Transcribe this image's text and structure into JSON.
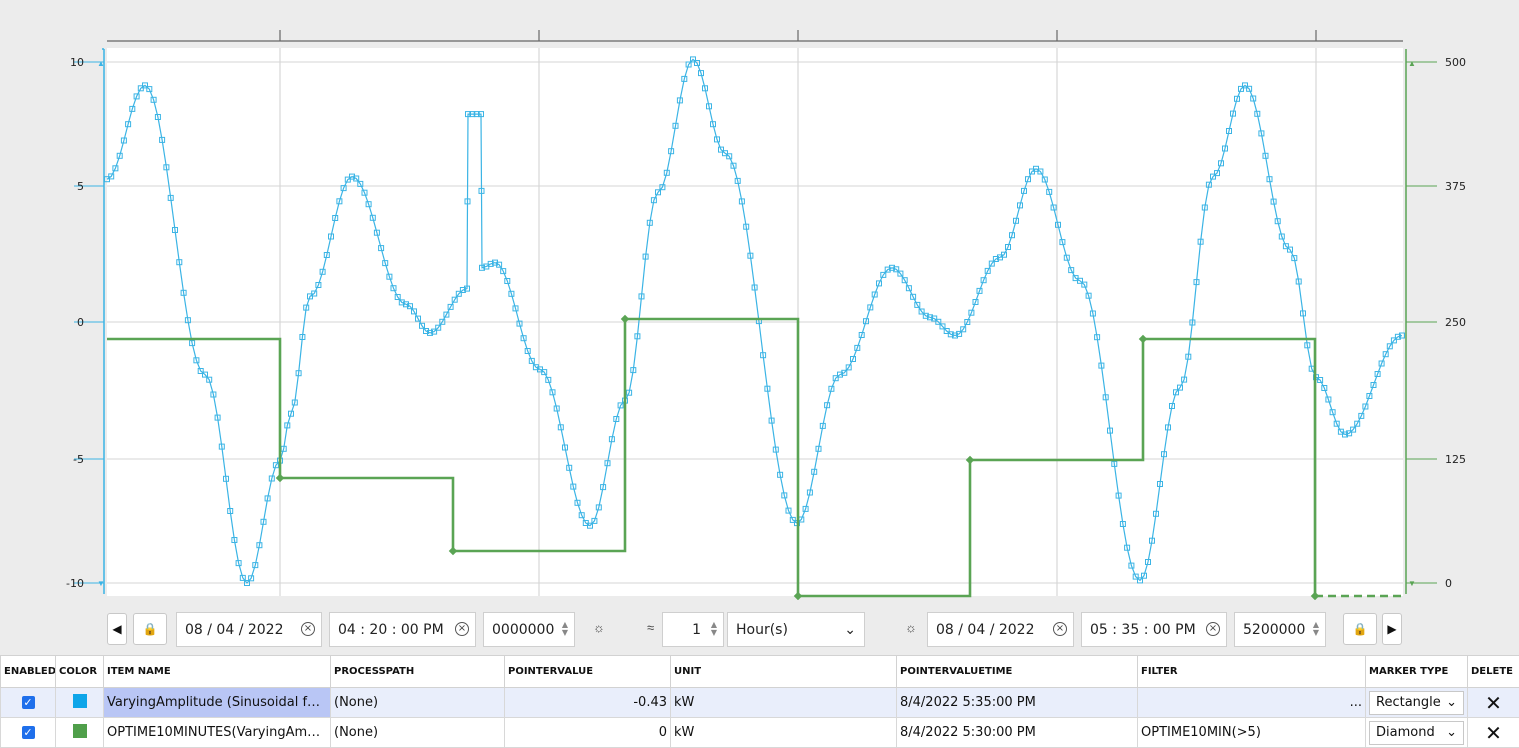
{
  "chart": {
    "left_axis": {
      "ticks": [
        "10",
        "5",
        "0",
        "-5",
        "-10"
      ],
      "color": "#3bb4e5"
    },
    "right_axis": {
      "ticks": [
        "500",
        "375",
        "250",
        "125",
        "0"
      ],
      "color": "#5aa454"
    },
    "series_colors": {
      "sine": "#3bb4e5",
      "step": "#5aa454"
    }
  },
  "chart_data": {
    "type": "line",
    "ylim_left": [
      -10,
      10
    ],
    "ylim_right": [
      0,
      500
    ],
    "series": [
      {
        "description_axis": "left",
        "marker": "Rectangle",
        "color": "#3bb4e5"
      },
      {
        "description_axis": "right",
        "marker": "Diamond",
        "color": "#5aa454",
        "steps": [
          {
            "x_end_index": 0,
            "value": 232
          },
          {
            "value": 105
          },
          {
            "value": 42
          },
          {
            "value": 252
          },
          {
            "value": 0
          },
          {
            "value": 114
          },
          {
            "value": 232
          },
          {
            "value": 0
          }
        ]
      }
    ]
  },
  "toolbar": {
    "start_date": "08 / 04 / 2022",
    "start_time": "04 : 20 : 00   PM",
    "start_ms": "0000000",
    "interval_value": "1",
    "interval_unit": "Hour(s)",
    "end_date": "08 / 04 / 2022",
    "end_time": "05 : 35 : 00   PM",
    "end_ms": "5200000"
  },
  "table": {
    "headers": [
      "ENABLED",
      "COLOR",
      "ITEM NAME",
      "PROCESSPATH",
      "POINTERVALUE",
      "UNIT",
      "POINTERVALUETIME",
      "FILTER",
      "MARKER TYPE",
      "DELETE"
    ],
    "rows": [
      {
        "color": "#0ea5e9",
        "item_name": "VaryingAmplitude (Sinusoidal f…",
        "processpath": "(None)",
        "pointervalue": "-0.43",
        "unit": "kW",
        "pointervaluetime": "8/4/2022 5:35:00 PM",
        "filter": "...",
        "marker_type": "Rectangle"
      },
      {
        "color": "#4f9f4a",
        "item_name": "OPTIME10MINUTES(VaryingAm…",
        "processpath": "(None)",
        "pointervalue": "0",
        "unit": "kW",
        "pointervaluetime": "8/4/2022 5:30:00 PM",
        "filter": "OPTIME10MIN(>5)",
        "marker_type": "Diamond"
      }
    ]
  }
}
